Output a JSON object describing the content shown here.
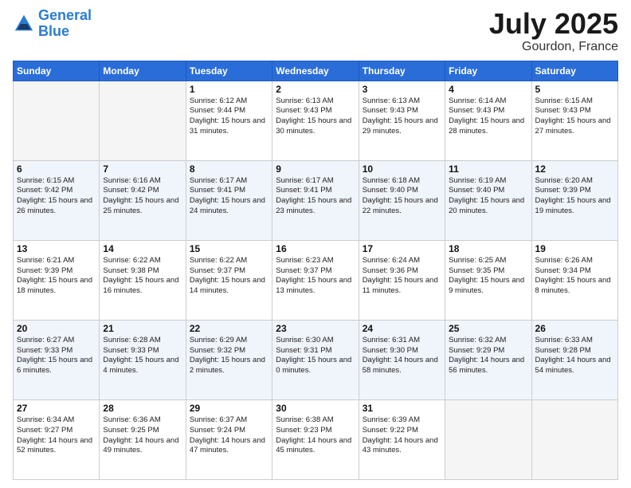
{
  "header": {
    "logo_line1": "General",
    "logo_line2": "Blue",
    "month": "July 2025",
    "location": "Gourdon, France"
  },
  "weekdays": [
    "Sunday",
    "Monday",
    "Tuesday",
    "Wednesday",
    "Thursday",
    "Friday",
    "Saturday"
  ],
  "weeks": [
    [
      {
        "day": "",
        "info": ""
      },
      {
        "day": "",
        "info": ""
      },
      {
        "day": "1",
        "info": "Sunrise: 6:12 AM\nSunset: 9:44 PM\nDaylight: 15 hours\nand 31 minutes."
      },
      {
        "day": "2",
        "info": "Sunrise: 6:13 AM\nSunset: 9:43 PM\nDaylight: 15 hours\nand 30 minutes."
      },
      {
        "day": "3",
        "info": "Sunrise: 6:13 AM\nSunset: 9:43 PM\nDaylight: 15 hours\nand 29 minutes."
      },
      {
        "day": "4",
        "info": "Sunrise: 6:14 AM\nSunset: 9:43 PM\nDaylight: 15 hours\nand 28 minutes."
      },
      {
        "day": "5",
        "info": "Sunrise: 6:15 AM\nSunset: 9:43 PM\nDaylight: 15 hours\nand 27 minutes."
      }
    ],
    [
      {
        "day": "6",
        "info": "Sunrise: 6:15 AM\nSunset: 9:42 PM\nDaylight: 15 hours\nand 26 minutes."
      },
      {
        "day": "7",
        "info": "Sunrise: 6:16 AM\nSunset: 9:42 PM\nDaylight: 15 hours\nand 25 minutes."
      },
      {
        "day": "8",
        "info": "Sunrise: 6:17 AM\nSunset: 9:41 PM\nDaylight: 15 hours\nand 24 minutes."
      },
      {
        "day": "9",
        "info": "Sunrise: 6:17 AM\nSunset: 9:41 PM\nDaylight: 15 hours\nand 23 minutes."
      },
      {
        "day": "10",
        "info": "Sunrise: 6:18 AM\nSunset: 9:40 PM\nDaylight: 15 hours\nand 22 minutes."
      },
      {
        "day": "11",
        "info": "Sunrise: 6:19 AM\nSunset: 9:40 PM\nDaylight: 15 hours\nand 20 minutes."
      },
      {
        "day": "12",
        "info": "Sunrise: 6:20 AM\nSunset: 9:39 PM\nDaylight: 15 hours\nand 19 minutes."
      }
    ],
    [
      {
        "day": "13",
        "info": "Sunrise: 6:21 AM\nSunset: 9:39 PM\nDaylight: 15 hours\nand 18 minutes."
      },
      {
        "day": "14",
        "info": "Sunrise: 6:22 AM\nSunset: 9:38 PM\nDaylight: 15 hours\nand 16 minutes."
      },
      {
        "day": "15",
        "info": "Sunrise: 6:22 AM\nSunset: 9:37 PM\nDaylight: 15 hours\nand 14 minutes."
      },
      {
        "day": "16",
        "info": "Sunrise: 6:23 AM\nSunset: 9:37 PM\nDaylight: 15 hours\nand 13 minutes."
      },
      {
        "day": "17",
        "info": "Sunrise: 6:24 AM\nSunset: 9:36 PM\nDaylight: 15 hours\nand 11 minutes."
      },
      {
        "day": "18",
        "info": "Sunrise: 6:25 AM\nSunset: 9:35 PM\nDaylight: 15 hours\nand 9 minutes."
      },
      {
        "day": "19",
        "info": "Sunrise: 6:26 AM\nSunset: 9:34 PM\nDaylight: 15 hours\nand 8 minutes."
      }
    ],
    [
      {
        "day": "20",
        "info": "Sunrise: 6:27 AM\nSunset: 9:33 PM\nDaylight: 15 hours\nand 6 minutes."
      },
      {
        "day": "21",
        "info": "Sunrise: 6:28 AM\nSunset: 9:33 PM\nDaylight: 15 hours\nand 4 minutes."
      },
      {
        "day": "22",
        "info": "Sunrise: 6:29 AM\nSunset: 9:32 PM\nDaylight: 15 hours\nand 2 minutes."
      },
      {
        "day": "23",
        "info": "Sunrise: 6:30 AM\nSunset: 9:31 PM\nDaylight: 15 hours\nand 0 minutes."
      },
      {
        "day": "24",
        "info": "Sunrise: 6:31 AM\nSunset: 9:30 PM\nDaylight: 14 hours\nand 58 minutes."
      },
      {
        "day": "25",
        "info": "Sunrise: 6:32 AM\nSunset: 9:29 PM\nDaylight: 14 hours\nand 56 minutes."
      },
      {
        "day": "26",
        "info": "Sunrise: 6:33 AM\nSunset: 9:28 PM\nDaylight: 14 hours\nand 54 minutes."
      }
    ],
    [
      {
        "day": "27",
        "info": "Sunrise: 6:34 AM\nSunset: 9:27 PM\nDaylight: 14 hours\nand 52 minutes."
      },
      {
        "day": "28",
        "info": "Sunrise: 6:36 AM\nSunset: 9:25 PM\nDaylight: 14 hours\nand 49 minutes."
      },
      {
        "day": "29",
        "info": "Sunrise: 6:37 AM\nSunset: 9:24 PM\nDaylight: 14 hours\nand 47 minutes."
      },
      {
        "day": "30",
        "info": "Sunrise: 6:38 AM\nSunset: 9:23 PM\nDaylight: 14 hours\nand 45 minutes."
      },
      {
        "day": "31",
        "info": "Sunrise: 6:39 AM\nSunset: 9:22 PM\nDaylight: 14 hours\nand 43 minutes."
      },
      {
        "day": "",
        "info": ""
      },
      {
        "day": "",
        "info": ""
      }
    ]
  ]
}
